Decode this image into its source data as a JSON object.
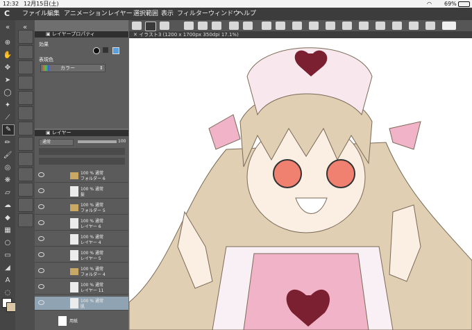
{
  "status_bar": {
    "time": "12:32",
    "date": "12月15日(土)",
    "battery": "69%"
  },
  "menu": {
    "logo": "C",
    "items": [
      "ファイル",
      "編集",
      "アニメーション",
      "レイヤー",
      "選択範囲",
      "表示",
      "フィルター",
      "ウィンドウ",
      "ヘルプ"
    ]
  },
  "layer_property": {
    "title": "レイヤープロパティ",
    "effect_label": "効果",
    "expression_label": "表現色",
    "expression_value": "カラー"
  },
  "layer_panel": {
    "title": "レイヤー",
    "blend_mode": "通常",
    "opacity": "100",
    "layers": [
      {
        "line1": "100 % 通常",
        "line2": "フォルダー 6",
        "kind": "folder"
      },
      {
        "line1": "100 % 通常",
        "line2": "髪",
        "kind": "layer"
      },
      {
        "line1": "100 % 通常",
        "line2": "フォルダー 5",
        "kind": "folder"
      },
      {
        "line1": "100 % 通常",
        "line2": "レイヤー 6",
        "kind": "layer"
      },
      {
        "line1": "100 % 通常",
        "line2": "レイヤー 4",
        "kind": "layer"
      },
      {
        "line1": "100 % 通常",
        "line2": "レイヤー 5",
        "kind": "layer"
      },
      {
        "line1": "100 % 通常",
        "line2": "フォルダー 4",
        "kind": "folder"
      },
      {
        "line1": "100 % 通常",
        "line2": "レイヤー 11",
        "kind": "layer"
      },
      {
        "line1": "100 % 通常",
        "line2": "肌",
        "kind": "layer",
        "selected": true
      }
    ],
    "paper_label": "用紙"
  },
  "canvas": {
    "tab_title": "イラスト3 (1200 x 1700px 350dpi 17.1%)"
  },
  "colors": {
    "main": "#ffffff",
    "sub": "#d9c7a8"
  }
}
